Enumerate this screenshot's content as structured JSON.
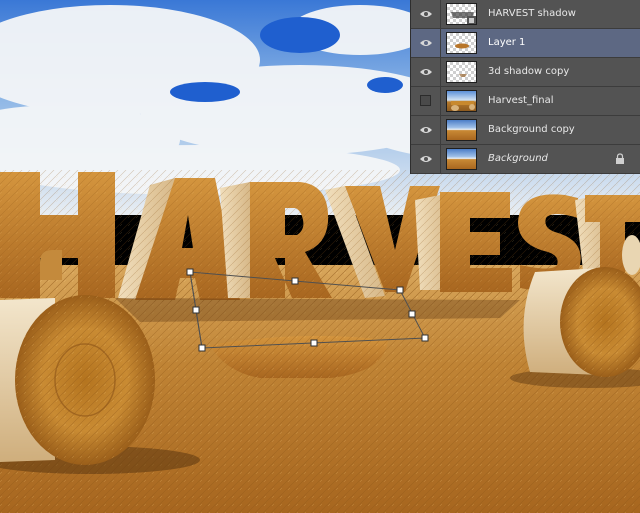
{
  "layers_panel": {
    "layers": [
      {
        "name": "HARVEST shadow",
        "visible": true,
        "thumb": "checker-with-mask-icon",
        "selected": false,
        "italic": false,
        "locked": false
      },
      {
        "name": "Layer 1",
        "visible": true,
        "thumb": "checker-hay-shadow",
        "selected": true,
        "italic": false,
        "locked": false
      },
      {
        "name": "3d shadow copy",
        "visible": true,
        "thumb": "checker-shadow",
        "selected": false,
        "italic": false,
        "locked": false
      },
      {
        "name": "Harvest_final",
        "visible": false,
        "thumb": "photo-final",
        "selected": false,
        "italic": false,
        "locked": false
      },
      {
        "name": "Background copy",
        "visible": true,
        "thumb": "photo-field",
        "selected": false,
        "italic": false,
        "locked": false
      },
      {
        "name": "Background",
        "visible": true,
        "thumb": "photo-field",
        "selected": false,
        "italic": true,
        "locked": true
      }
    ],
    "colors": {
      "panel": "#535353",
      "selected": "#5d6883",
      "text": "#e8e8e8"
    }
  },
  "canvas": {
    "headline": "HARVEST",
    "colors": {
      "sky": "#2f6fd0",
      "hay": "#c8892e",
      "ground": "#b4772a",
      "transform_box": "#5a5a5a"
    }
  }
}
